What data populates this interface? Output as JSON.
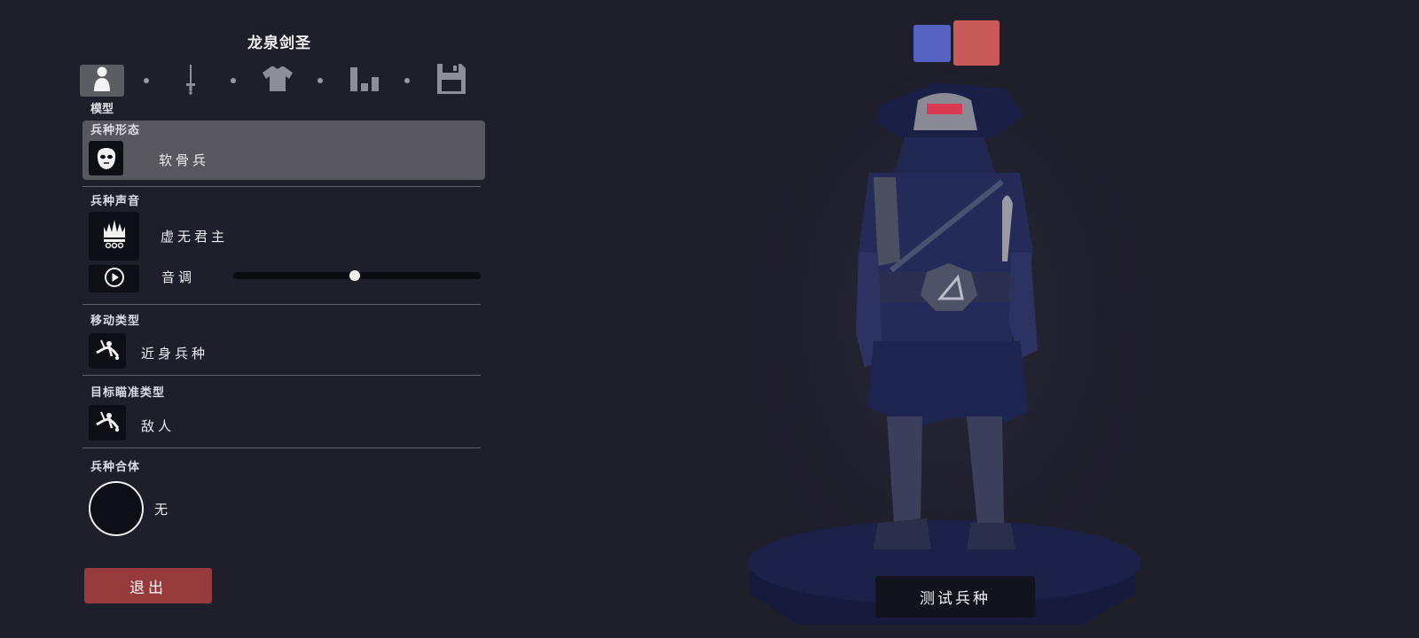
{
  "unit_name": "龙泉剑圣",
  "tabs": [
    {
      "icon": "person-icon",
      "active": true
    },
    {
      "icon": "sword-icon",
      "active": false
    },
    {
      "icon": "shirt-icon",
      "active": false
    },
    {
      "icon": "stats-icon",
      "active": false
    },
    {
      "icon": "save-icon",
      "active": false
    }
  ],
  "active_tab_label": "模型",
  "sections": {
    "unit_form": {
      "label": "兵种形态",
      "value": "软骨兵",
      "icon": "mask-icon"
    },
    "unit_voice": {
      "label": "兵种声音",
      "value": "虚无君主",
      "icon": "crown-icon",
      "pitch_label": "音调",
      "pitch_value": 0.49,
      "play_icon": "play-icon"
    },
    "movement_type": {
      "label": "移动类型",
      "value": "近身兵种",
      "icon": "melee-icon"
    },
    "targeting_type": {
      "label": "目标瞄准类型",
      "value": "敌人",
      "icon": "target-icon"
    },
    "unit_combine": {
      "label": "兵种合体",
      "value": "无"
    }
  },
  "exit_label": "退出",
  "team_colors": {
    "blue": "#5562c2",
    "red": "#c85a5a"
  },
  "test_button_label": "测试兵种",
  "colors": {
    "background": "#1f1e2b",
    "exit": "#963a3c",
    "highlight": "#58575d"
  }
}
